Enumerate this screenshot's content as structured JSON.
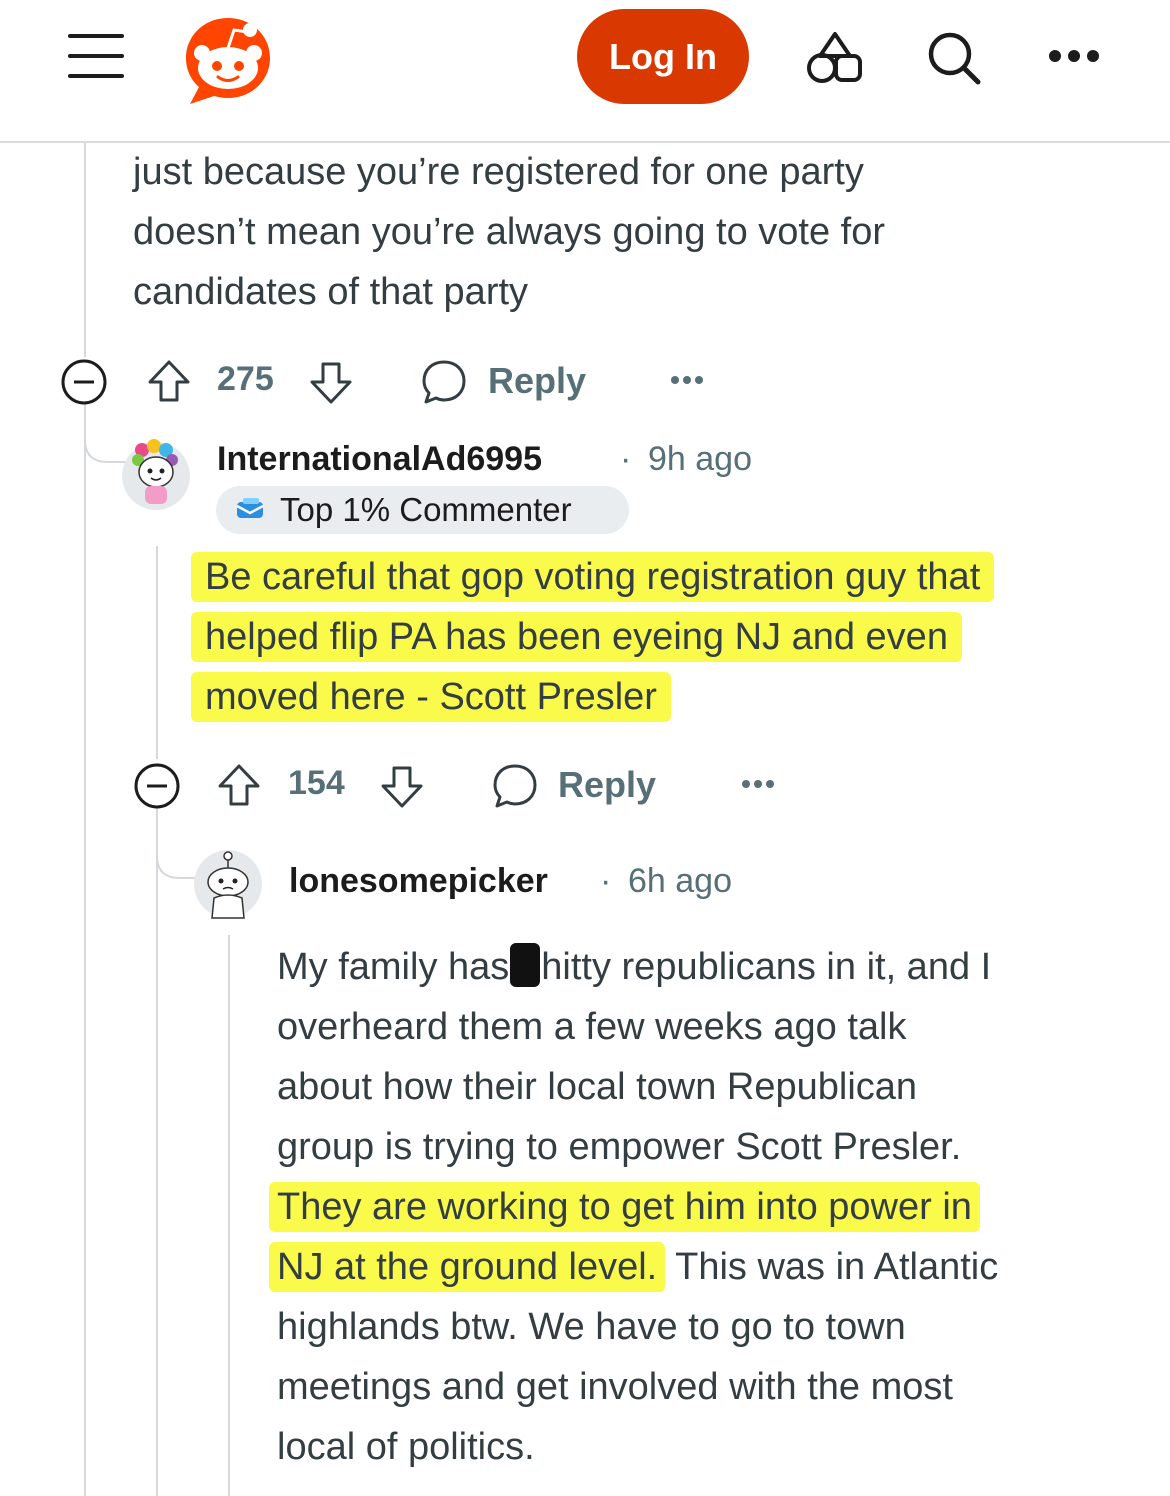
{
  "header": {
    "login_label": "Log In",
    "icons": [
      "menu-icon",
      "reddit-logo",
      "shapes-icon",
      "search-icon",
      "more-icon"
    ],
    "accent_color": "#d93900"
  },
  "comment_top": {
    "lines": [
      "just because you’re registered for one party",
      "doesn’t mean you’re always going to vote for",
      "candidates of that party"
    ],
    "score": "275",
    "reply_label": "Reply"
  },
  "comment_second": {
    "author": "InternationalAd6995",
    "separator": "·",
    "time": "9h ago",
    "badge": "Top 1% Commenter",
    "lines": [
      "Be careful that gop voting registration guy that",
      "helped flip PA has been eyeing NJ and even",
      "moved here - Scott Presler"
    ],
    "score": "154",
    "reply_label": "Reply",
    "highlight_color": "#fafa4a"
  },
  "comment_third": {
    "author": "lonesomepicker",
    "separator": "·",
    "time": "6h ago",
    "line1_before": "My family has",
    "line1_after": "hitty republicans in it, and I",
    "line2": "overheard them a few weeks ago talk",
    "line3": "about how their local town Republican",
    "line4": "group is trying to empower Scott Presler.",
    "line5_highlight": "They are working to get him into power in",
    "line6_highlight": "NJ at the ground level.",
    "line6_rest": " This was in Atlantic",
    "line7": "highlands btw. We have to go to town",
    "line8": "meetings and get involved with the most",
    "line9": "local of politics."
  }
}
